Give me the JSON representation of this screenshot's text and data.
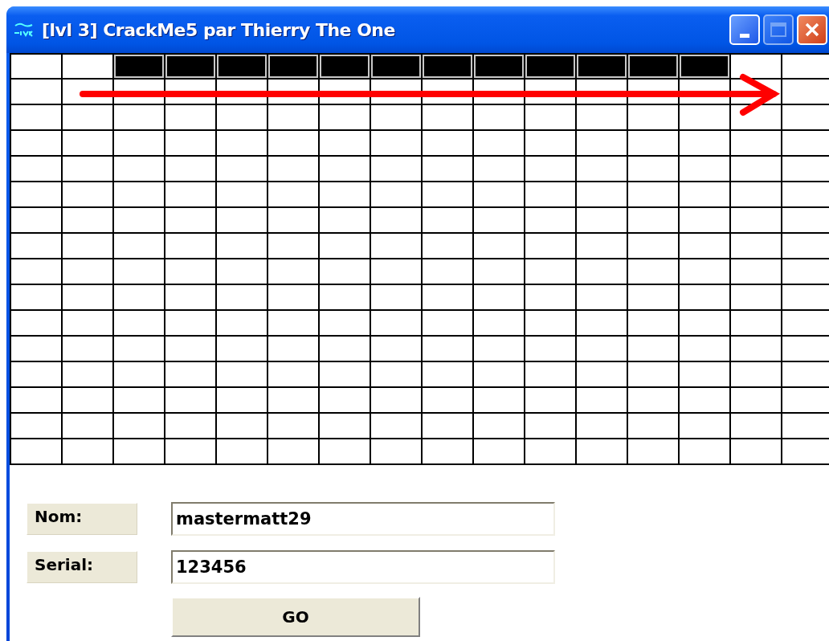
{
  "window": {
    "title": "[lvl 3] CrackMe5 par Thierry The One"
  },
  "grid": {
    "rows": [
      [
        false,
        false,
        true,
        true,
        true,
        true,
        true,
        true,
        true,
        true,
        true,
        true,
        true,
        true,
        false,
        false
      ],
      [
        false,
        false,
        false,
        false,
        false,
        false,
        false,
        false,
        false,
        false,
        false,
        false,
        false,
        false,
        false,
        false
      ],
      [
        false,
        false,
        false,
        false,
        false,
        false,
        false,
        false,
        false,
        false,
        false,
        false,
        false,
        false,
        false,
        false
      ],
      [
        false,
        false,
        false,
        false,
        false,
        false,
        false,
        false,
        false,
        false,
        false,
        false,
        false,
        false,
        false,
        false
      ],
      [
        false,
        false,
        false,
        false,
        false,
        false,
        false,
        false,
        false,
        false,
        false,
        false,
        false,
        false,
        false,
        false
      ],
      [
        false,
        false,
        false,
        false,
        false,
        false,
        false,
        false,
        false,
        false,
        false,
        false,
        false,
        false,
        false,
        false
      ],
      [
        false,
        false,
        false,
        false,
        false,
        false,
        false,
        false,
        false,
        false,
        false,
        false,
        false,
        false,
        false,
        false
      ],
      [
        false,
        false,
        false,
        false,
        false,
        false,
        false,
        false,
        false,
        false,
        false,
        false,
        false,
        false,
        false,
        false
      ],
      [
        false,
        false,
        false,
        false,
        false,
        false,
        false,
        false,
        false,
        false,
        false,
        false,
        false,
        false,
        false,
        false
      ],
      [
        false,
        false,
        false,
        false,
        false,
        false,
        false,
        false,
        false,
        false,
        false,
        false,
        false,
        false,
        false,
        false
      ],
      [
        false,
        false,
        false,
        false,
        false,
        false,
        false,
        false,
        false,
        false,
        false,
        false,
        false,
        false,
        false,
        false
      ],
      [
        false,
        false,
        false,
        false,
        false,
        false,
        false,
        false,
        false,
        false,
        false,
        false,
        false,
        false,
        false,
        false
      ],
      [
        false,
        false,
        false,
        false,
        false,
        false,
        false,
        false,
        false,
        false,
        false,
        false,
        false,
        false,
        false,
        false
      ],
      [
        false,
        false,
        false,
        false,
        false,
        false,
        false,
        false,
        false,
        false,
        false,
        false,
        false,
        false,
        false,
        false
      ],
      [
        false,
        false,
        false,
        false,
        false,
        false,
        false,
        false,
        false,
        false,
        false,
        false,
        false,
        false,
        false,
        false
      ],
      [
        false,
        false,
        false,
        false,
        false,
        false,
        false,
        false,
        false,
        false,
        false,
        false,
        false,
        false,
        false,
        false
      ]
    ]
  },
  "fields": [
    {
      "label": "Nom:",
      "value": "mastermatt29"
    },
    {
      "label": "Serial:",
      "value": "123456"
    }
  ],
  "button": "GO"
}
